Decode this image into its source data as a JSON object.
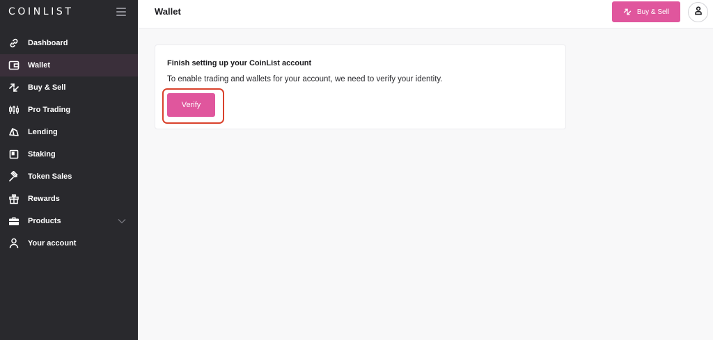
{
  "brand": {
    "name": "COINLIST"
  },
  "sidebar": {
    "items": [
      {
        "label": "Dashboard",
        "icon": "link-icon"
      },
      {
        "label": "Wallet",
        "icon": "wallet-icon",
        "active": true
      },
      {
        "label": "Buy & Sell",
        "icon": "arrows-swap-icon"
      },
      {
        "label": "Pro Trading",
        "icon": "candlestick-icon"
      },
      {
        "label": "Lending",
        "icon": "lending-icon"
      },
      {
        "label": "Staking",
        "icon": "staking-icon"
      },
      {
        "label": "Token Sales",
        "icon": "gavel-icon"
      },
      {
        "label": "Rewards",
        "icon": "gift-icon"
      },
      {
        "label": "Products",
        "icon": "briefcase-icon",
        "expandable": true
      },
      {
        "label": "Your account",
        "icon": "person-icon"
      }
    ]
  },
  "header": {
    "title": "Wallet",
    "buy_sell_label": "Buy & Sell",
    "buy_sell_icon": "arrows-swap-icon",
    "account_icon": "account-icon"
  },
  "setup_card": {
    "title": "Finish setting up your CoinList account",
    "description": "To enable trading and wallets for your account, we need to verify your identity.",
    "verify_label": "Verify"
  },
  "colors": {
    "sidebar_bg": "#29292d",
    "accent": "#e0569d",
    "highlight": "#d9412b"
  }
}
